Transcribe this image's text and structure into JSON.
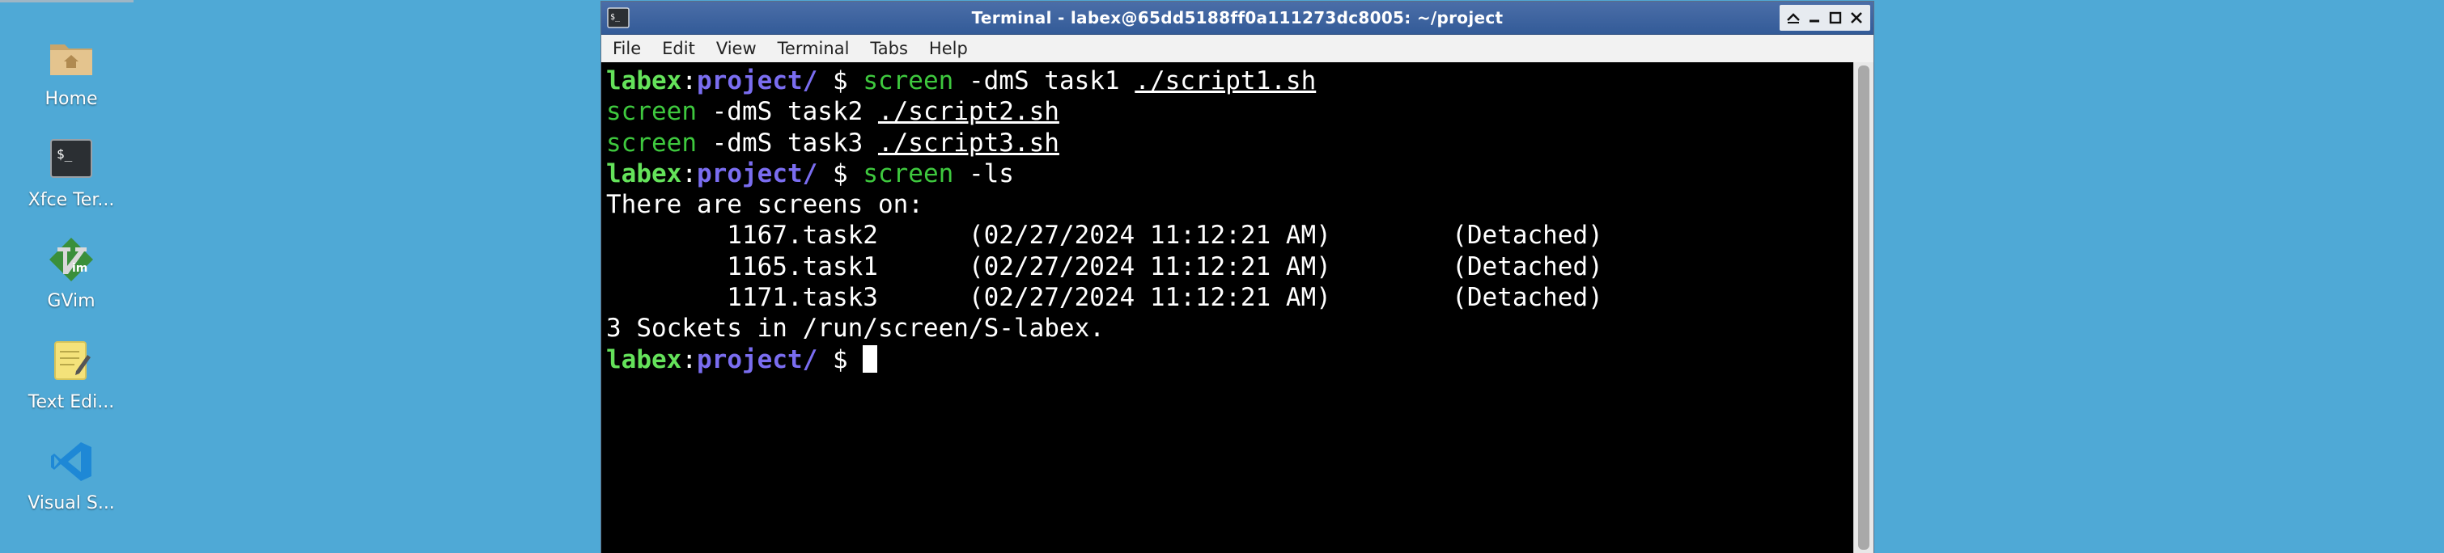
{
  "window": {
    "title": "Terminal - labex@65dd5188ff0a111273dc8005: ~/project"
  },
  "menu": [
    "File",
    "Edit",
    "View",
    "Terminal",
    "Tabs",
    "Help"
  ],
  "desktop_icons": [
    {
      "label": "Home",
      "icon": "home-folder-icon"
    },
    {
      "label": "Xfce Ter...",
      "icon": "terminal-icon"
    },
    {
      "label": "GVim",
      "icon": "gvim-icon"
    },
    {
      "label": "Text Edi...",
      "icon": "text-editor-icon"
    },
    {
      "label": "Visual S...",
      "icon": "vscode-icon"
    }
  ],
  "terminal": {
    "prompt_user": "labex",
    "prompt_path": "project/",
    "prompt_symbol": "$",
    "lines": [
      {
        "type": "prompt",
        "cmd": "screen",
        "args": " -dmS task1 ",
        "ul": "./script1.sh"
      },
      {
        "type": "cont",
        "cmd": "screen",
        "args": " -dmS task2 ",
        "ul": "./script2.sh"
      },
      {
        "type": "cont",
        "cmd": "screen",
        "args": " -dmS task3 ",
        "ul": "./script3.sh"
      },
      {
        "type": "prompt",
        "cmd": "screen",
        "args": " -ls",
        "ul": ""
      },
      {
        "type": "out",
        "text": "There are screens on:"
      },
      {
        "type": "out",
        "text": "        1167.task2      (02/27/2024 11:12:21 AM)        (Detached)"
      },
      {
        "type": "out",
        "text": "        1165.task1      (02/27/2024 11:12:21 AM)        (Detached)"
      },
      {
        "type": "out",
        "text": "        1171.task3      (02/27/2024 11:12:21 AM)        (Detached)"
      },
      {
        "type": "out",
        "text": "3 Sockets in /run/screen/S-labex."
      },
      {
        "type": "cursor"
      }
    ]
  }
}
